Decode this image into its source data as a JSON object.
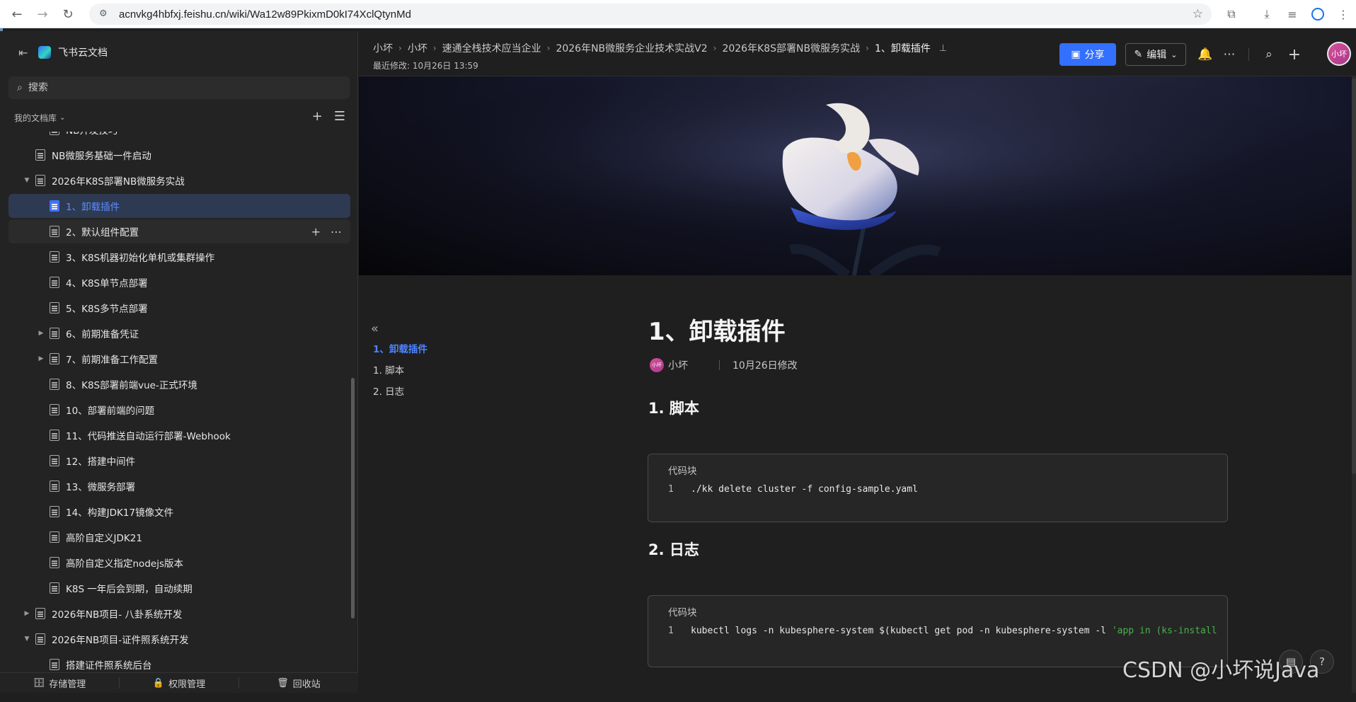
{
  "browser": {
    "url": "acnvkg4hbfxj.feishu.cn/wiki/Wa12w89PkixmD0kI74XclQtynMd"
  },
  "sidebar": {
    "brand": "飞书云文档",
    "search_placeholder": "搜索",
    "library_title": "我的文档库",
    "items": [
      {
        "label": "NB开发技巧",
        "indent": 2,
        "arrow": "",
        "state": ""
      },
      {
        "label": "NB微服务基础一件启动",
        "indent": 1,
        "arrow": "",
        "state": ""
      },
      {
        "label": "2026年K8S部署NB微服务实战",
        "indent": 1,
        "arrow": "down",
        "state": ""
      },
      {
        "label": "1、卸载插件",
        "indent": 2,
        "arrow": "",
        "state": "active"
      },
      {
        "label": "2、默认组件配置",
        "indent": 2,
        "arrow": "",
        "state": "hover"
      },
      {
        "label": "3、K8S机器初始化单机或集群操作",
        "indent": 2,
        "arrow": "",
        "state": ""
      },
      {
        "label": "4、K8S单节点部署",
        "indent": 2,
        "arrow": "",
        "state": ""
      },
      {
        "label": "5、K8S多节点部署",
        "indent": 2,
        "arrow": "",
        "state": ""
      },
      {
        "label": "6、前期准备凭证",
        "indent": 2,
        "arrow": "right",
        "state": ""
      },
      {
        "label": "7、前期准备工作配置",
        "indent": 2,
        "arrow": "right",
        "state": ""
      },
      {
        "label": "8、K8S部署前端vue-正式环境",
        "indent": 2,
        "arrow": "",
        "state": ""
      },
      {
        "label": "10、部署前端的问题",
        "indent": 2,
        "arrow": "",
        "state": ""
      },
      {
        "label": "11、代码推送自动运行部署-Webhook",
        "indent": 2,
        "arrow": "",
        "state": ""
      },
      {
        "label": "12、搭建中间件",
        "indent": 2,
        "arrow": "",
        "state": ""
      },
      {
        "label": "13、微服务部署",
        "indent": 2,
        "arrow": "",
        "state": ""
      },
      {
        "label": "14、构建JDK17镜像文件",
        "indent": 2,
        "arrow": "",
        "state": ""
      },
      {
        "label": "高阶自定义JDK21",
        "indent": 2,
        "arrow": "",
        "state": ""
      },
      {
        "label": "高阶自定义指定nodejs版本",
        "indent": 2,
        "arrow": "",
        "state": ""
      },
      {
        "label": "K8S 一年后会到期，自动续期",
        "indent": 2,
        "arrow": "",
        "state": ""
      },
      {
        "label": "2026年NB项目- 八卦系统开发",
        "indent": 1,
        "arrow": "right",
        "state": ""
      },
      {
        "label": "2026年NB项目-证件照系统开发",
        "indent": 1,
        "arrow": "down",
        "state": ""
      },
      {
        "label": "搭建证件照系统后台",
        "indent": 2,
        "arrow": "",
        "state": ""
      }
    ],
    "footer": {
      "storage": "存储管理",
      "permission": "权限管理",
      "trash": "回收站"
    }
  },
  "topbar": {
    "breadcrumb": [
      "小坏",
      "小坏",
      "速通全栈技术应当企业",
      "2026年NB微服务企业技术实战V2",
      "2026年K8S部署NB微服务实战",
      "1、卸载插件"
    ],
    "last_modified": "最近修改: 10月26日 13:59",
    "share_label": "分享",
    "edit_label": "编辑",
    "avatar_text": "小坏"
  },
  "toc": {
    "items": [
      "1、卸载插件",
      "1. 脚本",
      "2. 日志"
    ]
  },
  "document": {
    "title": "1、卸载插件",
    "author": "小坏",
    "author_avatar": "小坏",
    "modified": "10月26日修改",
    "section1": "1. 脚本",
    "section2": "2. 日志",
    "code1": {
      "title": "代码块",
      "line_no": "1",
      "code": "./kk delete cluster -f config-sample.yaml"
    },
    "code2": {
      "title": "代码块",
      "line_no": "1",
      "code": "kubectl logs -n kubesphere-system $(kubectl get pod -n kubesphere-system -l ",
      "code_str": "'app in (ks-install"
    }
  },
  "watermark": "CSDN @小坏说Java",
  "colors": {
    "accent": "#3370ff",
    "active_text": "#5b8dff",
    "background": "#1f1f1f"
  }
}
